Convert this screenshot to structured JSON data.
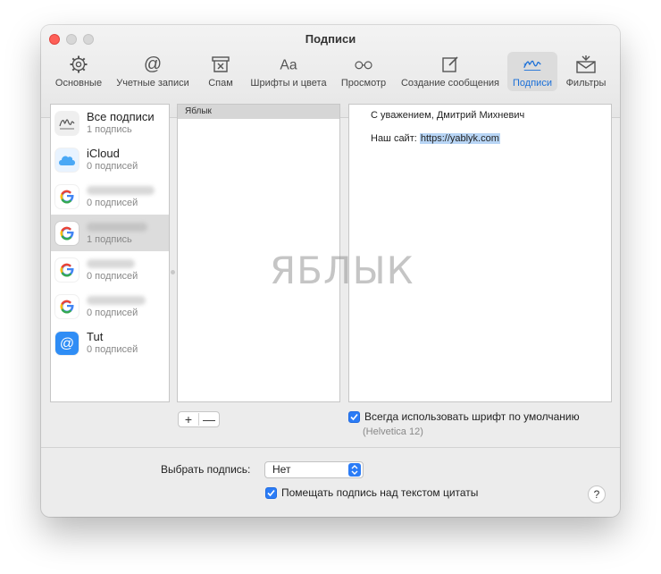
{
  "window": {
    "title": "Подписи"
  },
  "toolbar": {
    "items": [
      {
        "label": "Основные",
        "icon": "gear-icon"
      },
      {
        "label": "Учетные записи",
        "icon": "at-icon"
      },
      {
        "label": "Спам",
        "icon": "junk-icon"
      },
      {
        "label": "Шрифты и цвета",
        "icon": "fonts-icon"
      },
      {
        "label": "Просмотр",
        "icon": "glasses-icon"
      },
      {
        "label": "Создание сообщения",
        "icon": "compose-icon"
      },
      {
        "label": "Подписи",
        "icon": "signature-icon",
        "active": true
      },
      {
        "label": "Фильтры",
        "icon": "filters-icon"
      }
    ],
    "accent": "#1a6fd8"
  },
  "accounts": [
    {
      "name": "Все подписи",
      "count": "1 подпись",
      "icon": "signature-icon"
    },
    {
      "name": "iCloud",
      "count": "0 подписей",
      "icon": "icloud-icon"
    },
    {
      "name": "",
      "count": "0 подписей",
      "icon": "google-icon",
      "blurred": true
    },
    {
      "name": "",
      "count": "1 подпись",
      "icon": "google-icon",
      "blurred": true,
      "selected": true
    },
    {
      "name": "",
      "count": "0 подписей",
      "icon": "google-icon",
      "blurred": true
    },
    {
      "name": "",
      "count": "0 подписей",
      "icon": "google-icon",
      "blurred": true
    },
    {
      "name": "Tut",
      "count": "0 подписей",
      "icon": "at-mail-icon"
    }
  ],
  "signatures": {
    "items": [
      "Яблык"
    ]
  },
  "editor": {
    "line1": "С уважением, Дмитрий Михневич",
    "line2_prefix": "Наш сайт: ",
    "line2_link": "https://yablyk.com"
  },
  "buttons": {
    "add": "+",
    "remove": "—"
  },
  "options": {
    "default_font_label": "Всегда использовать шрифт по умолчанию",
    "default_font_checked": true,
    "font_name": "(Helvetica 12)",
    "choose_label": "Выбрать подпись:",
    "choose_value": "Нет",
    "place_above_label": "Помещать подпись над текстом цитаты",
    "place_above_checked": true,
    "help": "?"
  },
  "watermark": "ЯБЛЫК"
}
